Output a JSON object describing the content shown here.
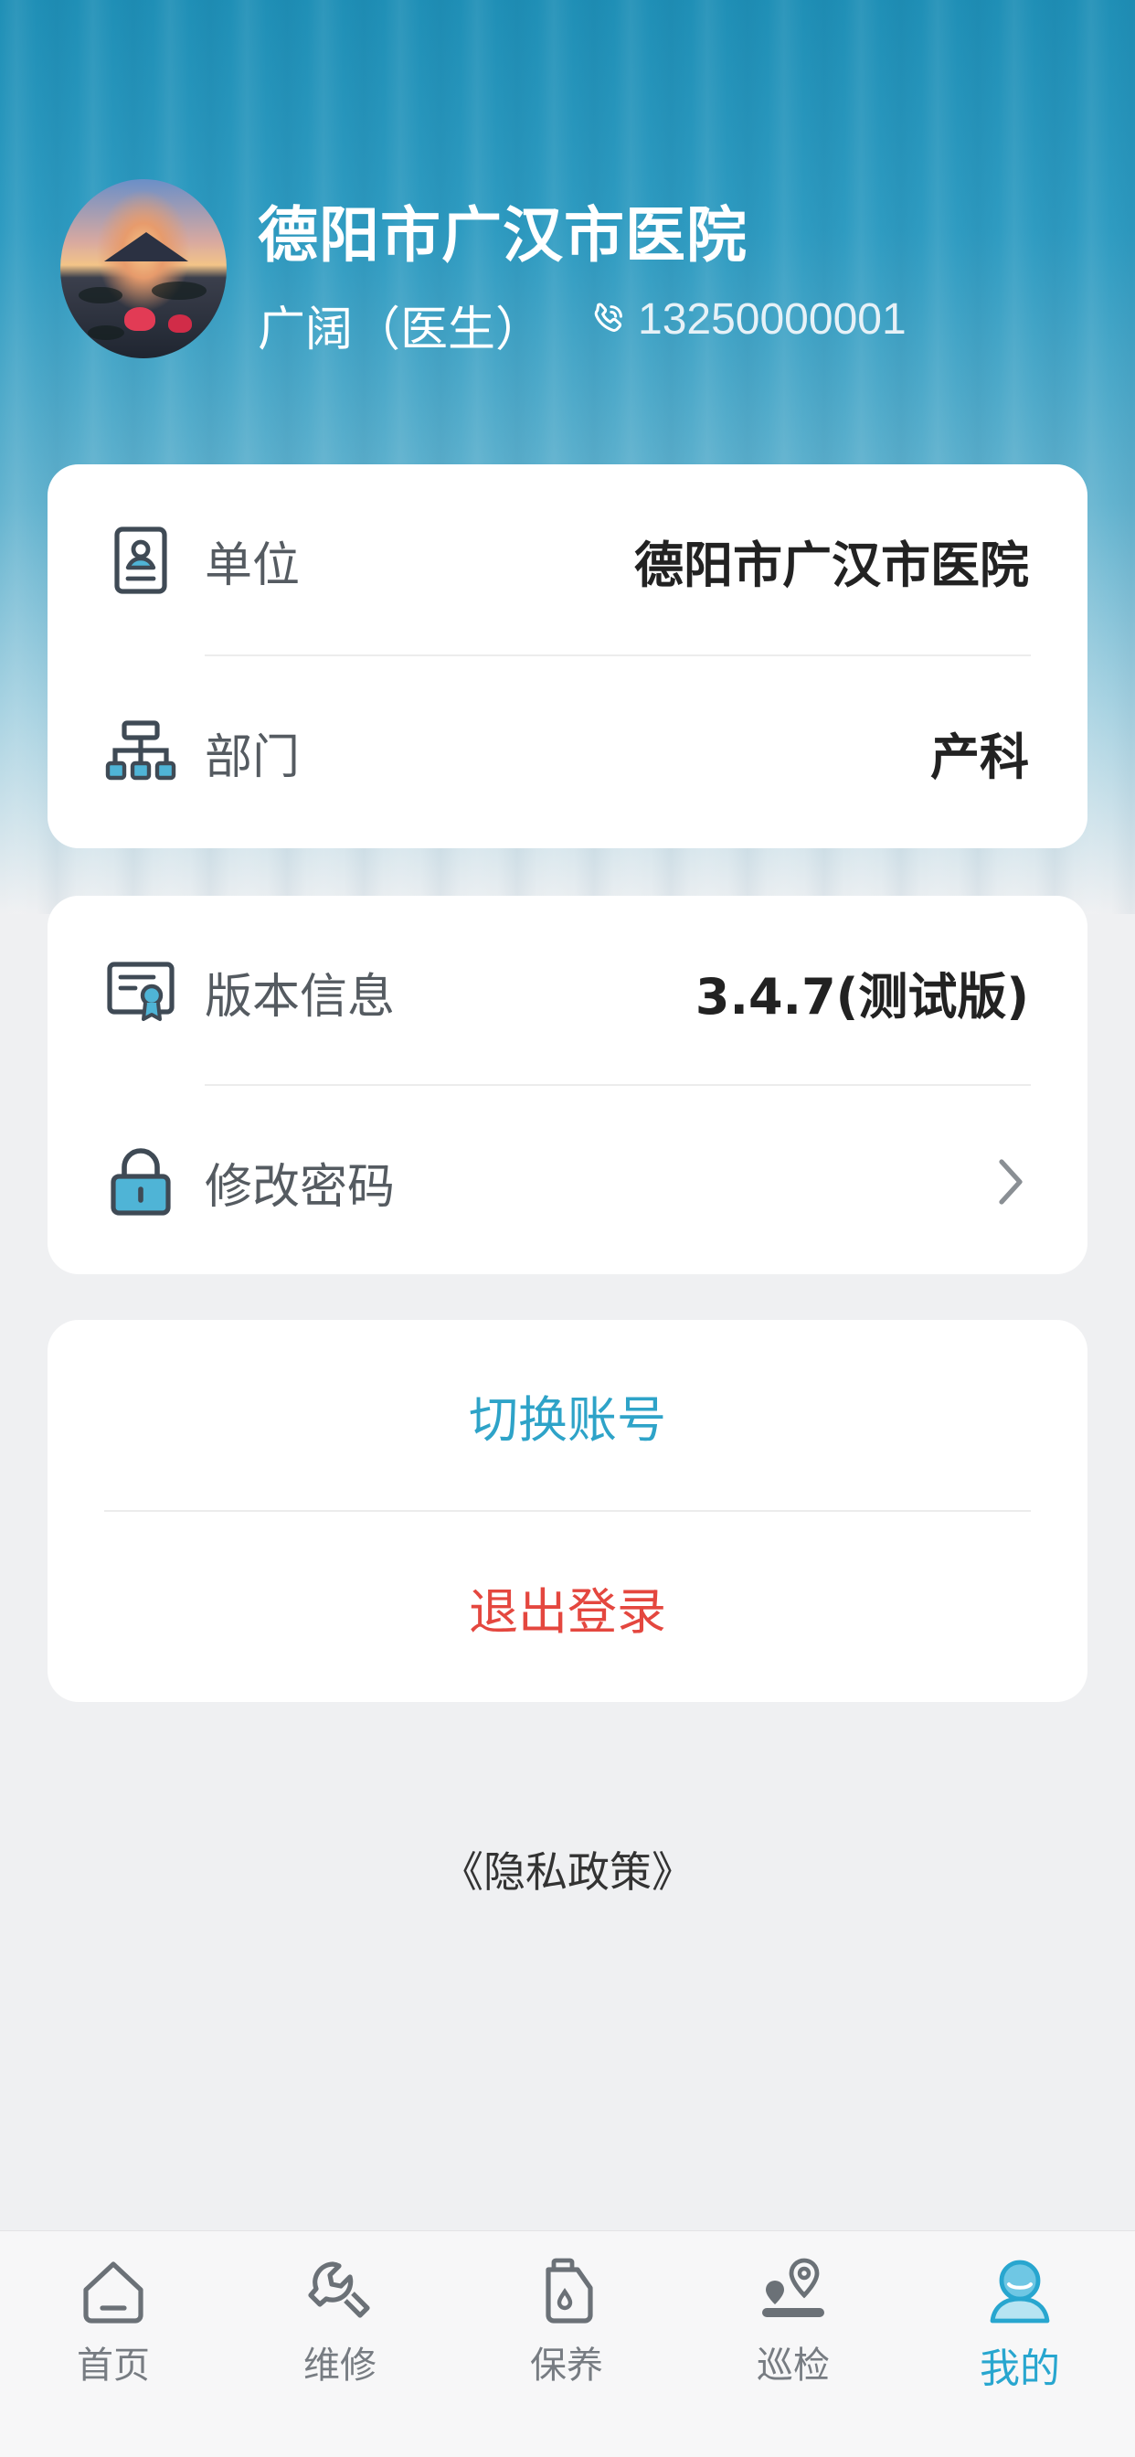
{
  "profile": {
    "hospital": "德阳市广汉市医院",
    "user": "广阔（医生）",
    "phone": "13250000001"
  },
  "info_card": {
    "unit_label": "单位",
    "unit_value": "德阳市广汉市医院",
    "dept_label": "部门",
    "dept_value": "产科"
  },
  "settings_card": {
    "version_label": "版本信息",
    "version_value": "3.4.7(测试版)",
    "password_label": "修改密码"
  },
  "actions": {
    "switch_account": "切换账号",
    "logout": "退出登录"
  },
  "privacy": "《隐私政策》",
  "tabbar": {
    "items": [
      {
        "label": "首页",
        "icon": "home-icon"
      },
      {
        "label": "维修",
        "icon": "wrench-icon"
      },
      {
        "label": "保养",
        "icon": "oil-can-icon"
      },
      {
        "label": "巡检",
        "icon": "location-pin-icon"
      },
      {
        "label": "我的",
        "icon": "user-icon"
      }
    ],
    "active_index": 4
  },
  "colors": {
    "accent": "#28a6cf",
    "danger": "#e4473f",
    "icon": "#3f4a55"
  }
}
